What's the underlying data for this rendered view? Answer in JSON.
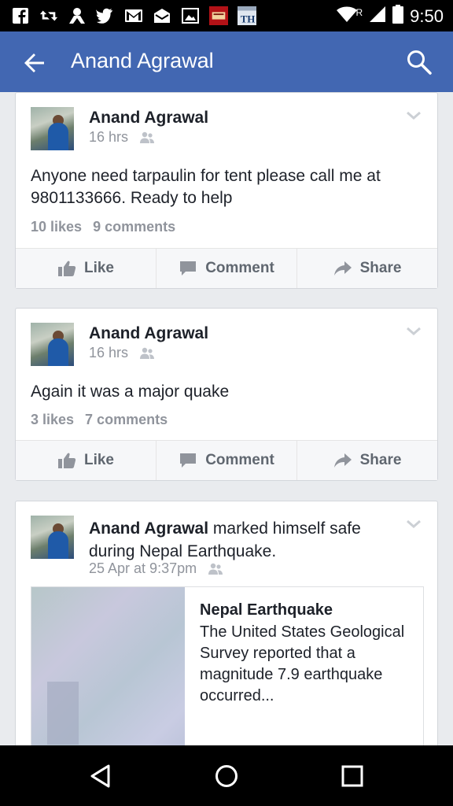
{
  "status_bar": {
    "time": "9:50",
    "roaming": "R",
    "left_icons": [
      "facebook-icon",
      "retweet-icon",
      "profile-icon",
      "twitter-icon",
      "gmail-icon",
      "mail-icon",
      "image-icon",
      "app-icon",
      "th-icon"
    ],
    "th_label": "TH"
  },
  "header": {
    "title": "Anand Agrawal"
  },
  "posts": [
    {
      "author": "Anand Agrawal",
      "time": "16 hrs",
      "text": "Anyone need tarpaulin for tent please call me at 9801133666. Ready to help",
      "likes": "10 likes",
      "comments": "9 comments"
    },
    {
      "author": "Anand Agrawal",
      "time": "16 hrs",
      "text": "Again it was a major quake",
      "likes": "3 likes",
      "comments": "7 comments"
    },
    {
      "author": "Anand Agrawal",
      "action_text": " marked himself safe during Nepal Earthquake.",
      "time": "25 Apr at 9:37pm",
      "link_title": "Nepal Earthquake",
      "link_description": "The United States Geological Survey reported that a magnitude 7.9 earthquake occurred..."
    }
  ],
  "actions": {
    "like": "Like",
    "comment": "Comment",
    "share": "Share"
  },
  "colors": {
    "brand": "#4267b2",
    "background": "#e9ebee",
    "muted_text": "#90949c"
  }
}
